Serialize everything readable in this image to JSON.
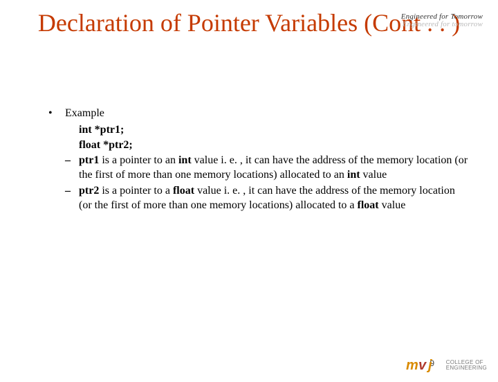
{
  "header": {
    "tagline": "Engineered for Tomorrow",
    "tagline_ghost": "Engineered for tomorrow"
  },
  "title": "Declaration of Pointer Variables (Cont . . )",
  "content": {
    "bullet_label": "Example",
    "code1": "int *ptr1;",
    "code2": "float *ptr2;",
    "sub1": {
      "b1": "ptr1",
      "t1": " is a pointer to an ",
      "b2": "int",
      "t2": " value i. e. , it can have the address of the memory location (or the first of more than one memory locations) allocated to an ",
      "b3": "int",
      "t3": " value"
    },
    "sub2": {
      "b1": "ptr2",
      "t1": " is a pointer to a ",
      "b2": "float",
      "t2": " value i. e. , it can have the address of the memory location (or the first of more than one memory locations) allocated to a ",
      "b3": "float",
      "t3": " value"
    }
  },
  "footer": {
    "page_number": "9",
    "logo_brand": "mvj",
    "logo_sub1": "COLLEGE OF",
    "logo_sub2": "ENGINEERING"
  }
}
